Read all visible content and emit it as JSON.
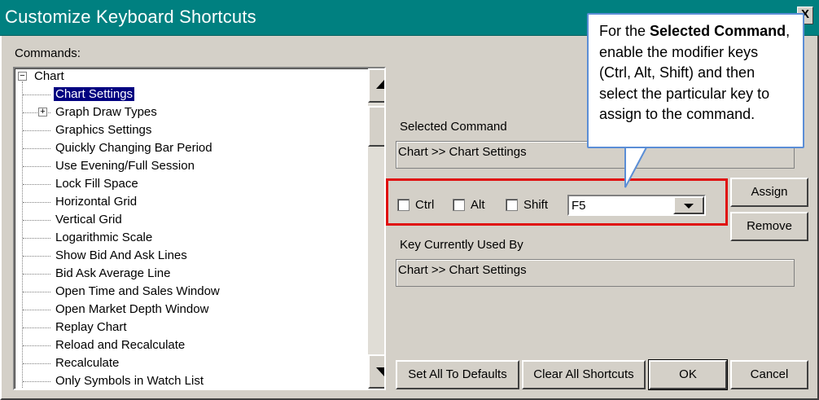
{
  "window": {
    "title": "Customize Keyboard Shortcuts",
    "close_glyph": "X"
  },
  "commands": {
    "label": "Commands:",
    "root": {
      "label": "Chart",
      "expander": "−"
    },
    "items": [
      {
        "label": "Chart Settings",
        "selected": true
      },
      {
        "label": "Graph Draw Types",
        "expander": "+"
      },
      {
        "label": "Graphics Settings"
      },
      {
        "label": "Quickly Changing Bar Period"
      },
      {
        "label": "Use Evening/Full Session"
      },
      {
        "label": "Lock Fill Space"
      },
      {
        "label": "Horizontal Grid"
      },
      {
        "label": "Vertical Grid"
      },
      {
        "label": "Logarithmic Scale"
      },
      {
        "label": "Show Bid And Ask Lines"
      },
      {
        "label": "Bid Ask Average Line"
      },
      {
        "label": "Open Time and Sales Window"
      },
      {
        "label": "Open Market Depth Window"
      },
      {
        "label": "Replay Chart"
      },
      {
        "label": "Reload and Recalculate"
      },
      {
        "label": "Recalculate"
      },
      {
        "label": "Only Symbols in Watch List"
      }
    ]
  },
  "selected_command": {
    "label": "Selected Command",
    "value": "Chart >> Chart Settings"
  },
  "modifiers": {
    "ctrl": "Ctrl",
    "alt": "Alt",
    "shift": "Shift",
    "key_value": "F5"
  },
  "key_used_by": {
    "label": "Key Currently Used By",
    "value": "Chart >> Chart Settings"
  },
  "buttons": {
    "assign": "Assign",
    "remove": "Remove",
    "set_defaults": "Set All To Defaults",
    "clear_all": "Clear All Shortcuts",
    "ok": "OK",
    "cancel": "Cancel"
  },
  "callout": {
    "part1": "For the ",
    "bold1": "Selected Command",
    "part2": ", enable the modifier keys (Ctrl, Alt, Shift) and then select the particular key to assign to the command."
  },
  "colors": {
    "titlebar": "#008080",
    "selection": "#000080",
    "highlight_box": "#e01010",
    "callout_border": "#5b8ed6"
  }
}
